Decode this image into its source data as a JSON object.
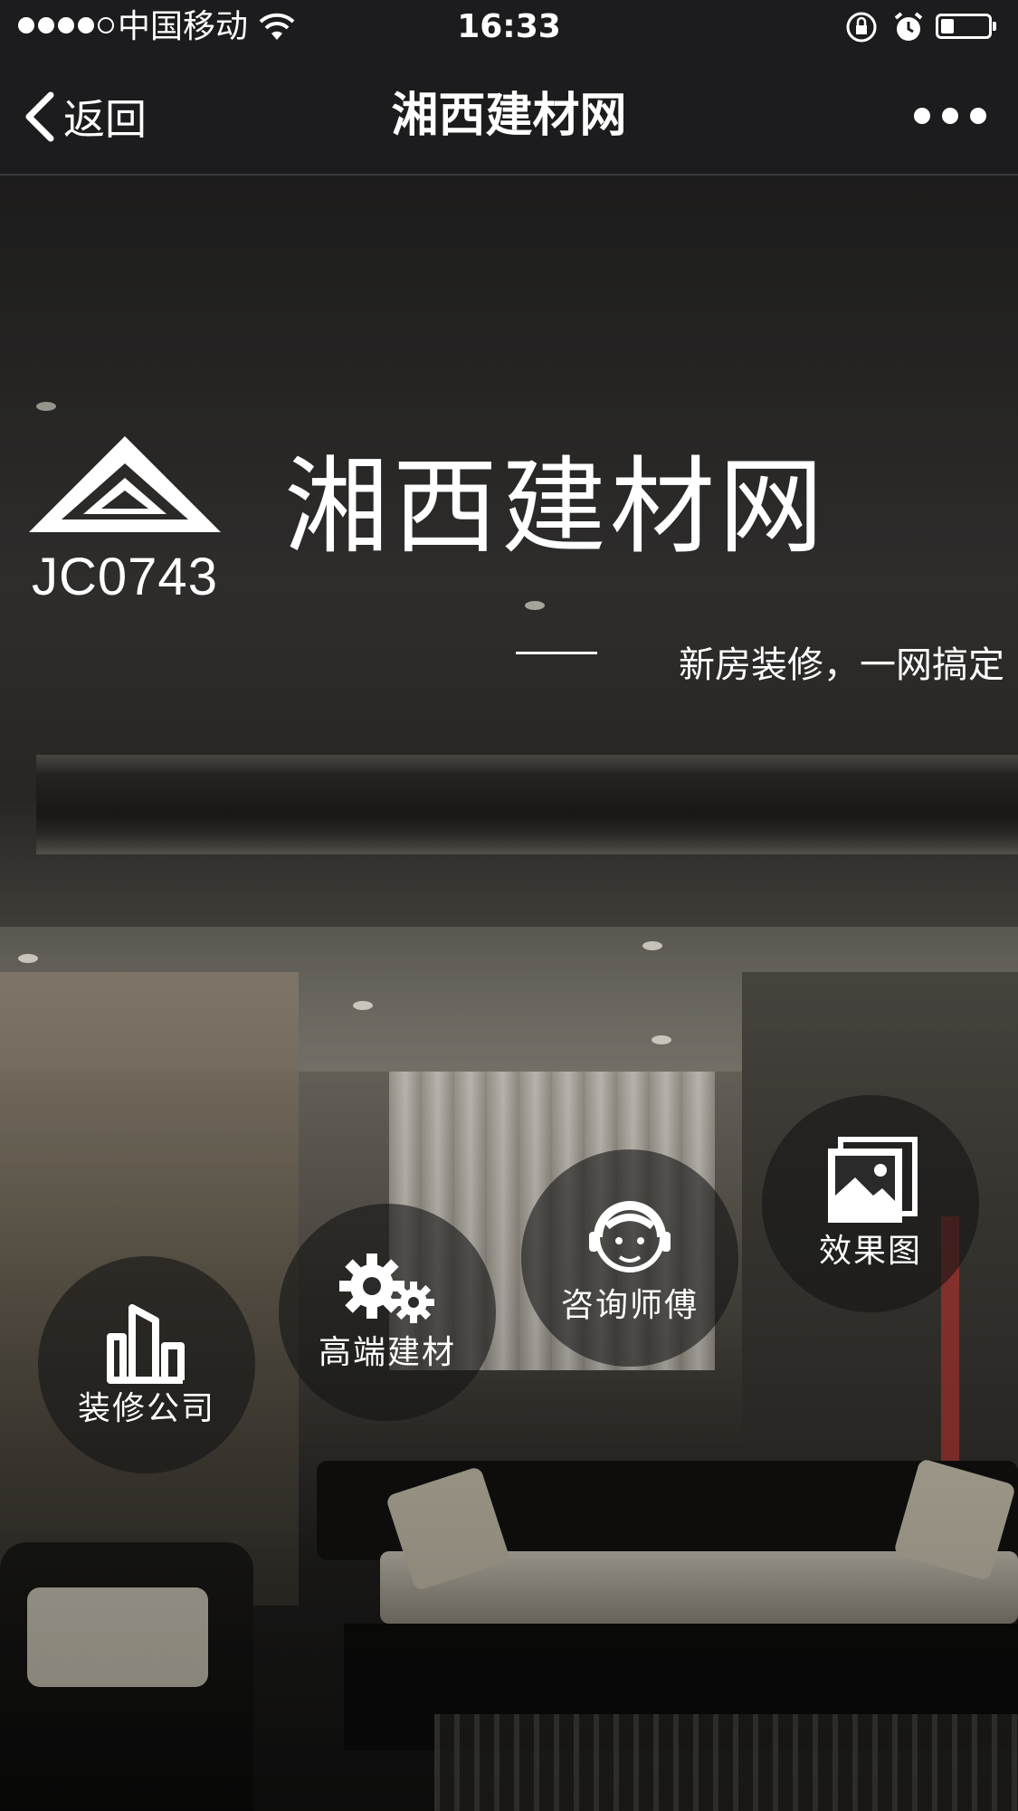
{
  "status_bar": {
    "carrier": "中国移动",
    "time": "16:33",
    "signal_bars_filled": 4,
    "signal_bars_total": 5,
    "battery_level": 0.2
  },
  "nav": {
    "back_label": "返回",
    "title": "湘西建材网"
  },
  "brand": {
    "logo_code": "JC0743",
    "title": "湘西建材网",
    "tagline": "新房装修，一网搞定"
  },
  "menu": {
    "decor_company": {
      "label": "装修公司",
      "icon": "buildings-icon"
    },
    "premium_materials": {
      "label": "高端建材",
      "icon": "gears-icon"
    },
    "consultant": {
      "label": "咨询师傅",
      "icon": "headset-face-icon"
    },
    "renderings": {
      "label": "效果图",
      "icon": "picture-icon"
    }
  },
  "colors": {
    "bar_background": "#1c1c1e",
    "text": "#ffffff",
    "circle_fill": "rgba(20,20,20,0.6)"
  }
}
